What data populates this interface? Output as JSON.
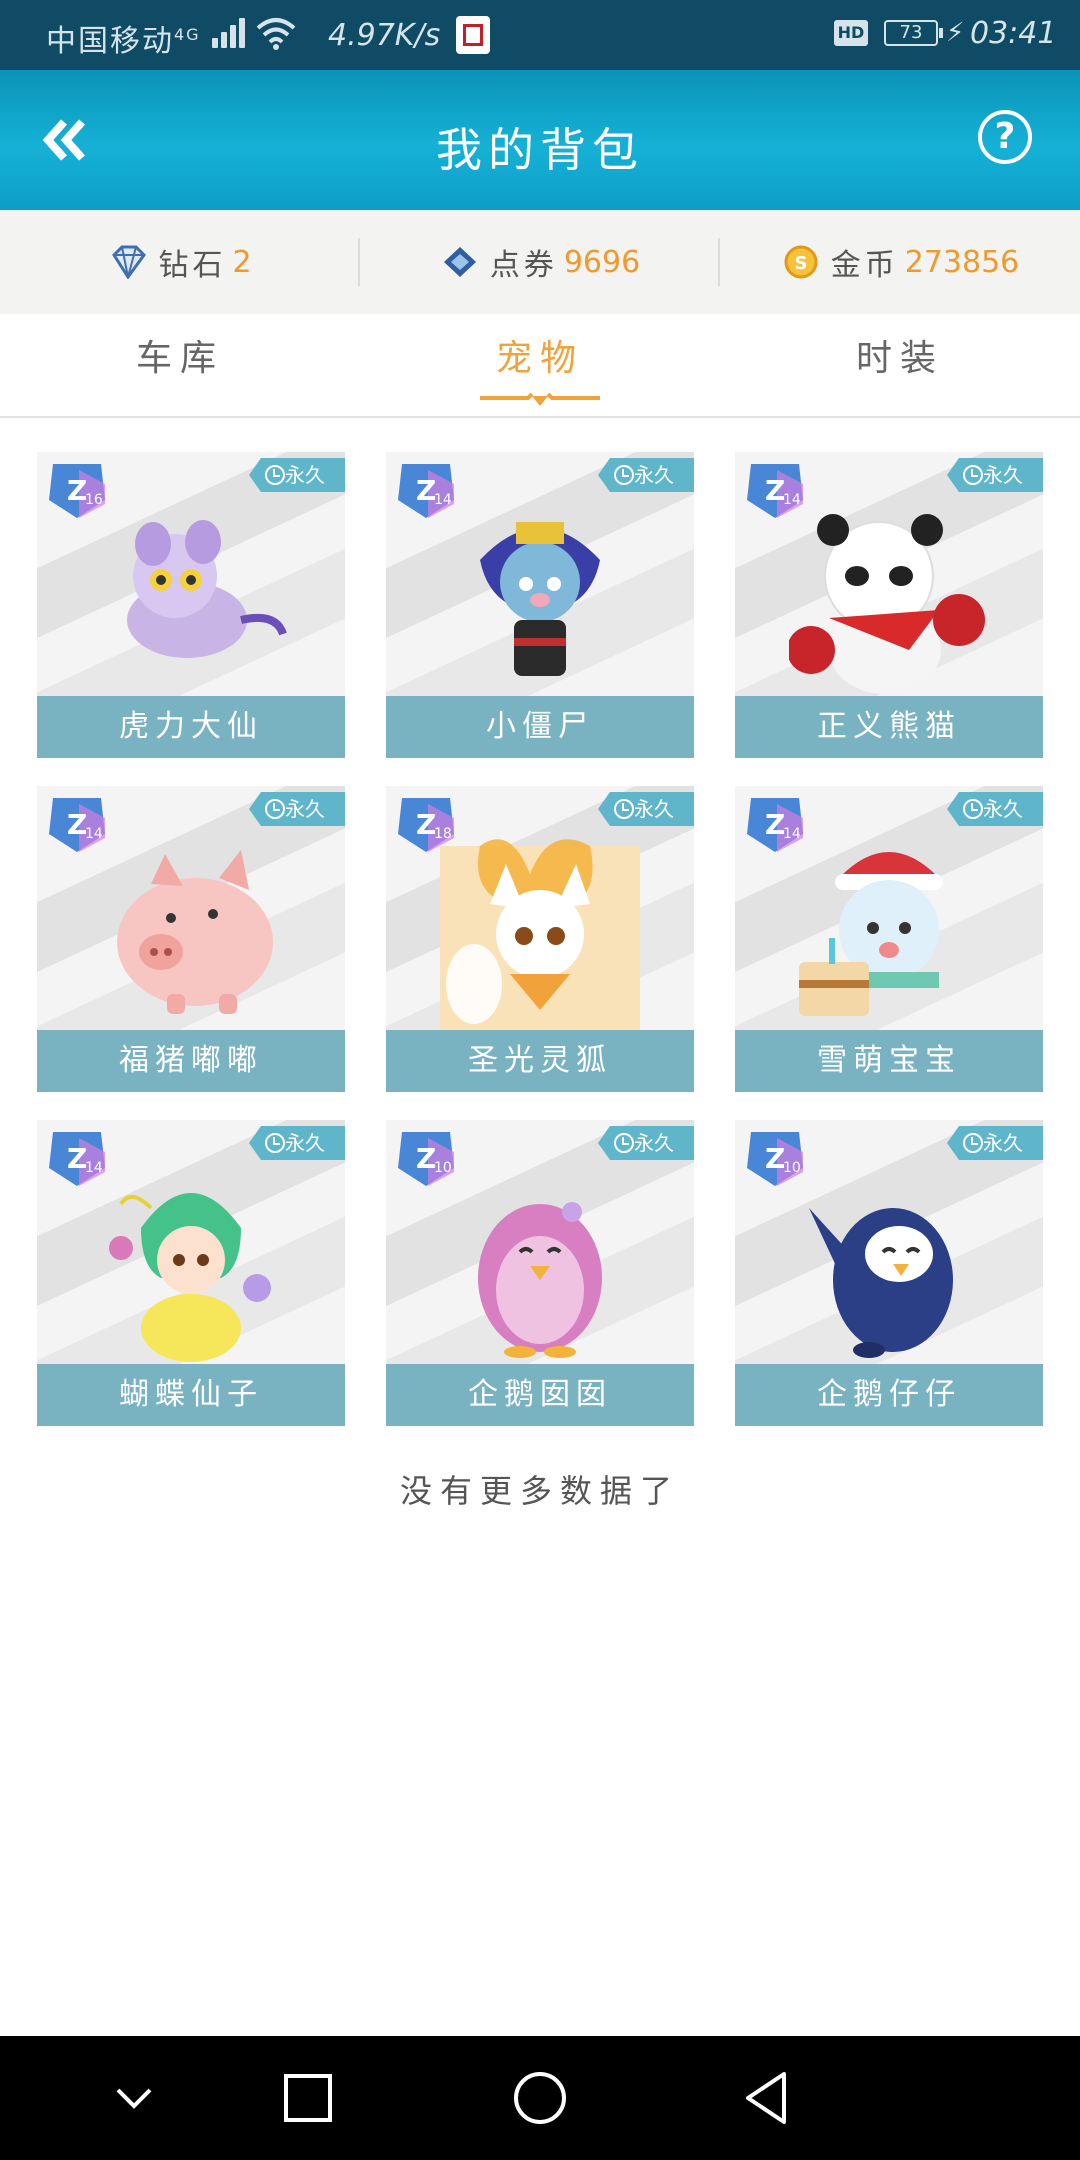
{
  "status_bar": {
    "carrier": "中国移动",
    "network_type": "4G",
    "speed": "4.97K/s",
    "hd": "HD",
    "battery": "73",
    "time": "03:41"
  },
  "header": {
    "title": "我的背包",
    "back_icon": "double-chevron-left-icon",
    "help_icon": "question-circle-icon",
    "help_label": "?"
  },
  "currencies": [
    {
      "label": "钻石",
      "value": "2",
      "icon": "diamond-icon"
    },
    {
      "label": "点券",
      "value": "9696",
      "icon": "coupon-icon"
    },
    {
      "label": "金币",
      "value": "273856",
      "icon": "gold-coin-icon"
    }
  ],
  "tabs": [
    {
      "label": "车库",
      "active": false
    },
    {
      "label": "宠物",
      "active": true
    },
    {
      "label": "时装",
      "active": false
    }
  ],
  "pets": [
    {
      "name": "虎力大仙",
      "level": "16",
      "duration": "永久"
    },
    {
      "name": "小僵尸",
      "level": "14",
      "duration": "永久"
    },
    {
      "name": "正义熊猫",
      "level": "14",
      "duration": "永久"
    },
    {
      "name": "福猪嘟嘟",
      "level": "14",
      "duration": "永久"
    },
    {
      "name": "圣光灵狐",
      "level": "18",
      "duration": "永久"
    },
    {
      "name": "雪萌宝宝",
      "level": "14",
      "duration": "永久"
    },
    {
      "name": "蝴蝶仙子",
      "level": "14",
      "duration": "永久"
    },
    {
      "name": "企鹅囡囡",
      "level": "10",
      "duration": "永久"
    },
    {
      "name": "企鹅仔仔",
      "level": "10",
      "duration": "永久"
    }
  ],
  "footer_text": "没有更多数据了",
  "colors": {
    "header": "#16b1d6",
    "accent": "#f2a23a",
    "name_bar": "#79b3c2",
    "badge": "#5fb6cb"
  }
}
